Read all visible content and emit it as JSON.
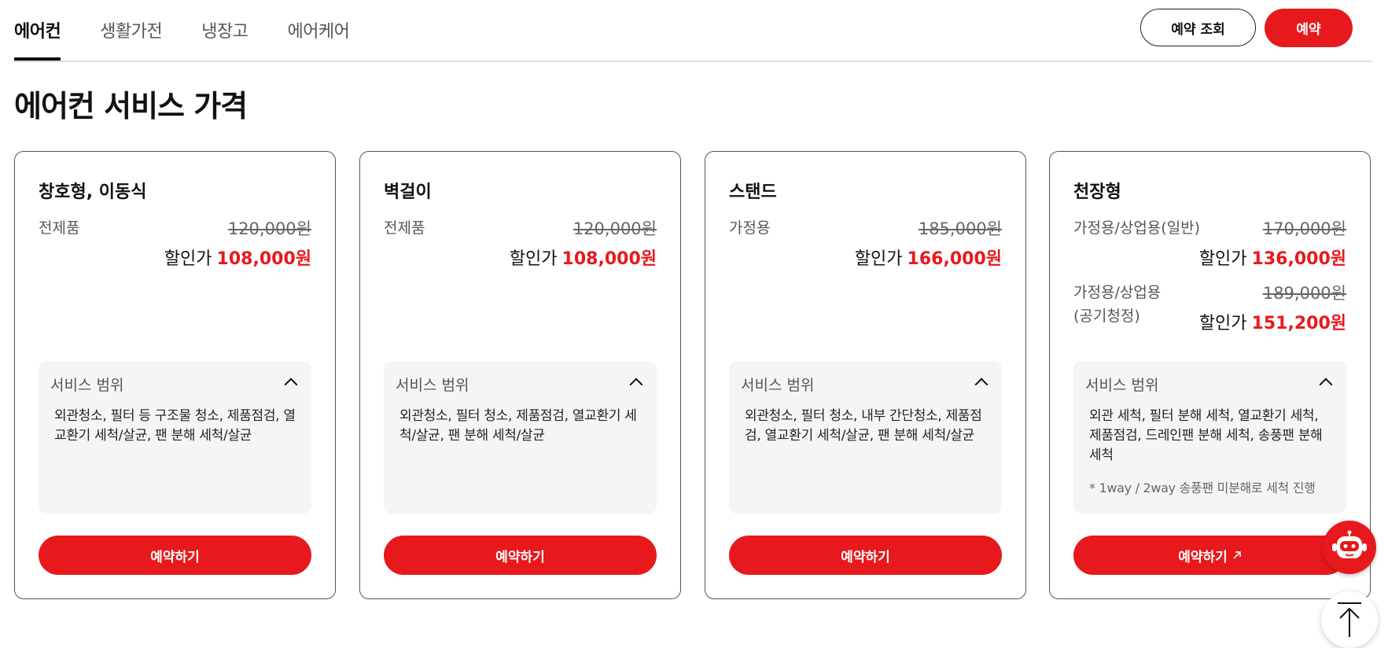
{
  "nav": {
    "tabs": [
      "에어컨",
      "생활가전",
      "냉장고",
      "에어케어"
    ],
    "active_tab": "에어컨",
    "lookup_label": "예약 조회",
    "reserve_label": "예약"
  },
  "page_title": "에어컨 서비스 가격",
  "colors": {
    "accent": "#e8191c",
    "text": "#111111",
    "muted": "#555555",
    "panel": "#f5f5f5"
  },
  "discount_prefix": "할인가",
  "scope_title": "서비스 범위",
  "cards": [
    {
      "title": "창호형, 이동식",
      "prices": [
        {
          "label": "전제품",
          "original": "120,000원",
          "discount": "108,000원"
        }
      ],
      "scope": "외관청소, 필터 등 구조물 청소, 제품점검, 열교환기 세척/살균, 팬 분해 세척/살균",
      "button": "예약하기"
    },
    {
      "title": "벽걸이",
      "prices": [
        {
          "label": "전제품",
          "original": "120,000원",
          "discount": "108,000원"
        }
      ],
      "scope": "외관청소, 필터 청소, 제품점검, 열교환기 세척/살균, 팬 분해 세척/살균",
      "button": "예약하기"
    },
    {
      "title": "스탠드",
      "prices": [
        {
          "label": "가정용",
          "original": "185,000원",
          "discount": "166,000원"
        }
      ],
      "scope": "외관청소, 필터 청소, 내부 간단청소, 제품점검, 열교환기 세척/살균, 팬 분해 세척/살균",
      "button": "예약하기"
    },
    {
      "title": "천장형",
      "prices": [
        {
          "label": "가정용/상업용(일반)",
          "original": "170,000원",
          "discount": "136,000원"
        },
        {
          "label": "가정용/상업용\n(공기청정)",
          "original": "189,000원",
          "discount": "151,200원"
        }
      ],
      "scope": "외관 세척, 필터 분해 세척, 열교환기 세척, 제품점검, 드레인팬 분해 세척, 송풍팬 분해 세척",
      "note": "* 1way / 2way 송풍팬 미분해로 세척 진행",
      "button": "예약하기"
    }
  ]
}
